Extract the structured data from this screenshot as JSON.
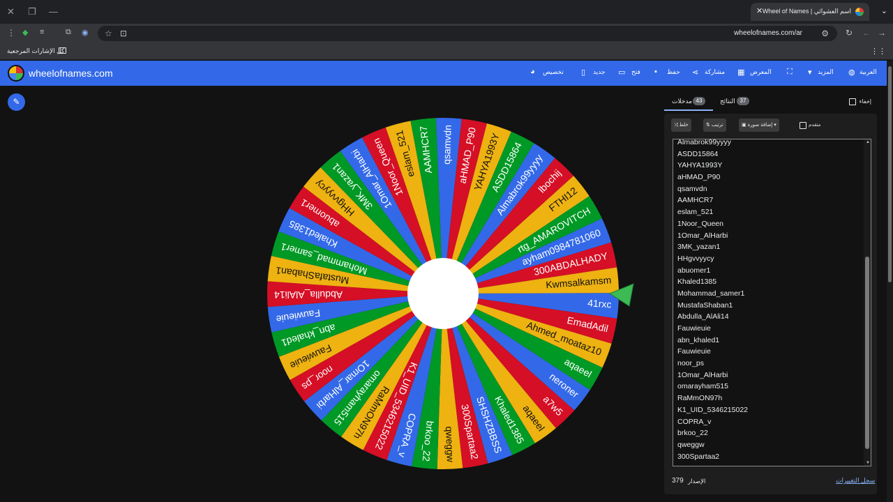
{
  "browser": {
    "tab_title": "Wheel of Names | اسم العشوائي",
    "url": "wheelofnames.com/ar",
    "bookmarks_label": "كل الإشارات المرجعية",
    "icons": [
      "close-icon",
      "restore-icon",
      "minimize-icon",
      "new-tab-icon",
      "menu-icon",
      "back-icon",
      "forward-icon",
      "reload-icon",
      "star-icon",
      "extensions-icon"
    ]
  },
  "header": {
    "brand": "wheelofnames.com",
    "menu": {
      "customize": "تخصيص",
      "new": "جديد",
      "open": "فتح",
      "save": "حفظ",
      "share": "مشاركة",
      "gallery": "المعرض",
      "more": "المزيد",
      "language": "العربية"
    }
  },
  "wheel": {
    "colors": [
      "#3369e8",
      "#d50f25",
      "#eeb211",
      "#009925"
    ],
    "center_color": "#ffffff",
    "pointer_color": "#3cba54",
    "start_angle_deg": 4,
    "entries": [
      "41rxc",
      "EmadAdil",
      "Ahmed_moataz10",
      "aqaeel",
      "neroner",
      "a7w5",
      "aqaeel",
      "Khaled1385",
      "SHSHZBBSS",
      "300Spartaa2",
      "qweggw",
      "brkoo_22",
      "COPRA_v",
      "K1_UID_5346215022",
      "RaMmON97h",
      "omarayham515",
      "1Omar_AlHarbi",
      "noor_ps",
      "Fauwieuie",
      "abn_khaled1",
      "Fauwieuie",
      "Abdulla_AlAli14",
      "MustafaShaban1",
      "Mohammad_samer1",
      "Khaled1385",
      "abuomer1",
      "HHgvvyycy",
      "3MK_yazan1",
      "1Omar_AlHarbi",
      "1Noor_Queen",
      "eslam_521",
      "AAMHCR7",
      "qsamvdn",
      "aHMAD_P90",
      "YAHYA1993Y",
      "ASDD15864",
      "Almabrok99yyyy",
      "lbochij",
      "FTHI12",
      "rtg_AMAROVITCH",
      "ayham0984781060",
      "300ABDALHADY",
      "Kwmsalkamsm"
    ]
  },
  "panel": {
    "hide_label": "إخفاء",
    "tab_results": "النتائج",
    "results_count": "37",
    "tab_entries": "مدخلات",
    "entries_count": "43",
    "shuffle": "خلط",
    "sort": "ترتيب",
    "add_image": "إضافة صورة",
    "advanced": "متقدم",
    "entries_list": [
      "Almabrok99yyyy",
      "ASDD15864",
      "YAHYA1993Y",
      "aHMAD_P90",
      "qsamvdn",
      "AAMHCR7",
      "eslam_521",
      "1Noor_Queen",
      "1Omar_AlHarbi",
      "3MK_yazan1",
      "HHgvvyycy",
      "abuomer1",
      "Khaled1385",
      "Mohammad_samer1",
      "MustafaShaban1",
      "Abdulla_AlAli14",
      "Fauwieuie",
      "abn_khaled1",
      "Fauwieuie",
      "noor_ps",
      "1Omar_AlHarbi",
      "omarayham515",
      "RaMmON97h",
      "K1_UID_5346215022",
      "COPRA_v",
      "brkoo_22",
      "qweggw",
      "300Spartaa2"
    ],
    "version_label": "الإصدار",
    "version_number": "379",
    "changelog": "سجل التغييرات"
  }
}
